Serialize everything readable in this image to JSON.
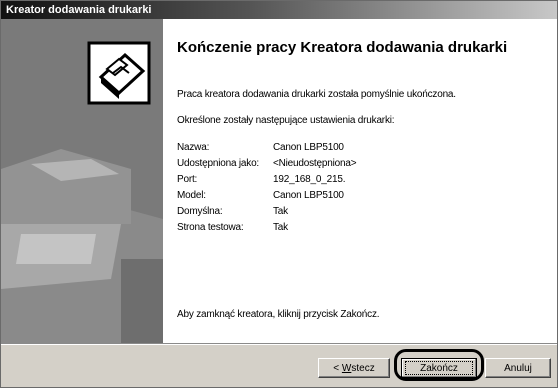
{
  "window": {
    "title": "Kreator dodawania drukarki"
  },
  "content": {
    "heading": "Kończenie pracy Kreatora dodawania drukarki",
    "success_text": "Praca kreatora dodawania drukarki została pomyślnie ukończona.",
    "settings_intro": "Określone zostały następujące ustawienia drukarki:",
    "settings": [
      {
        "label": "Nazwa:",
        "value": "Canon LBP5100"
      },
      {
        "label": "Udostępniona jako:",
        "value": "<Nieudostępniona>"
      },
      {
        "label": "Port:",
        "value": "192_168_0_215."
      },
      {
        "label": "Model:",
        "value": "Canon LBP5100"
      },
      {
        "label": "Domyślna:",
        "value": "Tak"
      },
      {
        "label": "Strona testowa:",
        "value": "Tak"
      }
    ],
    "close_hint": "Aby zamknąć kreatora, kliknij przycisk Zakończ."
  },
  "buttons": {
    "back_prefix": "< ",
    "back_accel": "W",
    "back_rest": "stecz",
    "finish": "Zakończ",
    "cancel": "Anuluj"
  },
  "icons": {
    "wizard": "printer-wizard-icon"
  },
  "colors": {
    "title_bar": "#111111",
    "left_panel": "#7a7a7a",
    "footer": "#d4d0c8"
  }
}
